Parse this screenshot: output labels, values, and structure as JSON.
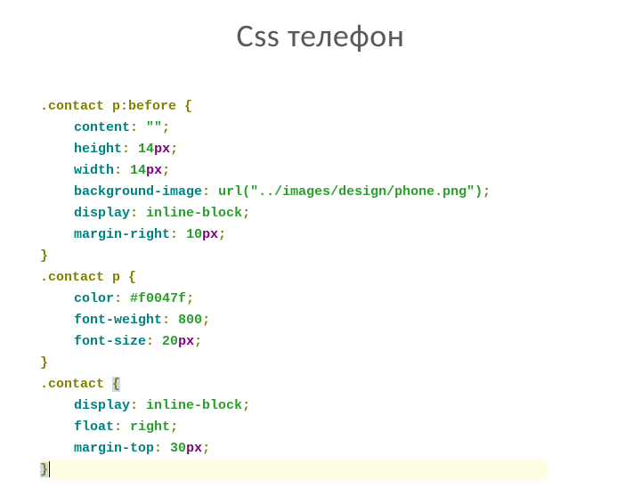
{
  "title": "Css телефон",
  "code": {
    "rule1": {
      "selector": ".contact p:before",
      "decl": [
        {
          "prop": "content",
          "rest": "",
          "p3": " \"\"",
          "p4": "",
          "p5": ""
        },
        {
          "prop": "height",
          "rest": " ",
          "p3": "14",
          "p4": "px",
          "p5": ""
        },
        {
          "prop": "width",
          "rest": " ",
          "p3": "14",
          "p4": "px",
          "p5": ""
        },
        {
          "prop": "background-image",
          "rest": " ",
          "p3": "url(",
          "p4": "",
          "p5": "\"../images/design/phone.png\"",
          "p6": ")"
        },
        {
          "prop": "display",
          "rest": " ",
          "p3": "inline-block",
          "p4": "",
          "p5": ""
        },
        {
          "prop": "margin-right",
          "rest": " ",
          "p3": "10",
          "p4": "px",
          "p5": ""
        }
      ]
    },
    "rule2": {
      "selector": ".contact p",
      "decl": [
        {
          "prop": "color",
          "rest": " ",
          "p3": "#f0047f",
          "p4": "",
          "p5": ""
        },
        {
          "prop": "font-weight",
          "rest": " ",
          "p3": "800",
          "p4": "",
          "p5": ""
        },
        {
          "prop": "font-size",
          "rest": " ",
          "p3": "20",
          "p4": "px",
          "p5": ""
        }
      ]
    },
    "rule3": {
      "selector": ".contact",
      "decl": [
        {
          "prop": "display",
          "rest": " ",
          "p3": "inline-block",
          "p4": "",
          "p5": ""
        },
        {
          "prop": "float",
          "rest": " ",
          "p3": "right",
          "p4": "",
          "p5": ""
        },
        {
          "prop": "margin-top",
          "rest": " ",
          "p3": "30",
          "p4": "px",
          "p5": ""
        }
      ]
    }
  }
}
